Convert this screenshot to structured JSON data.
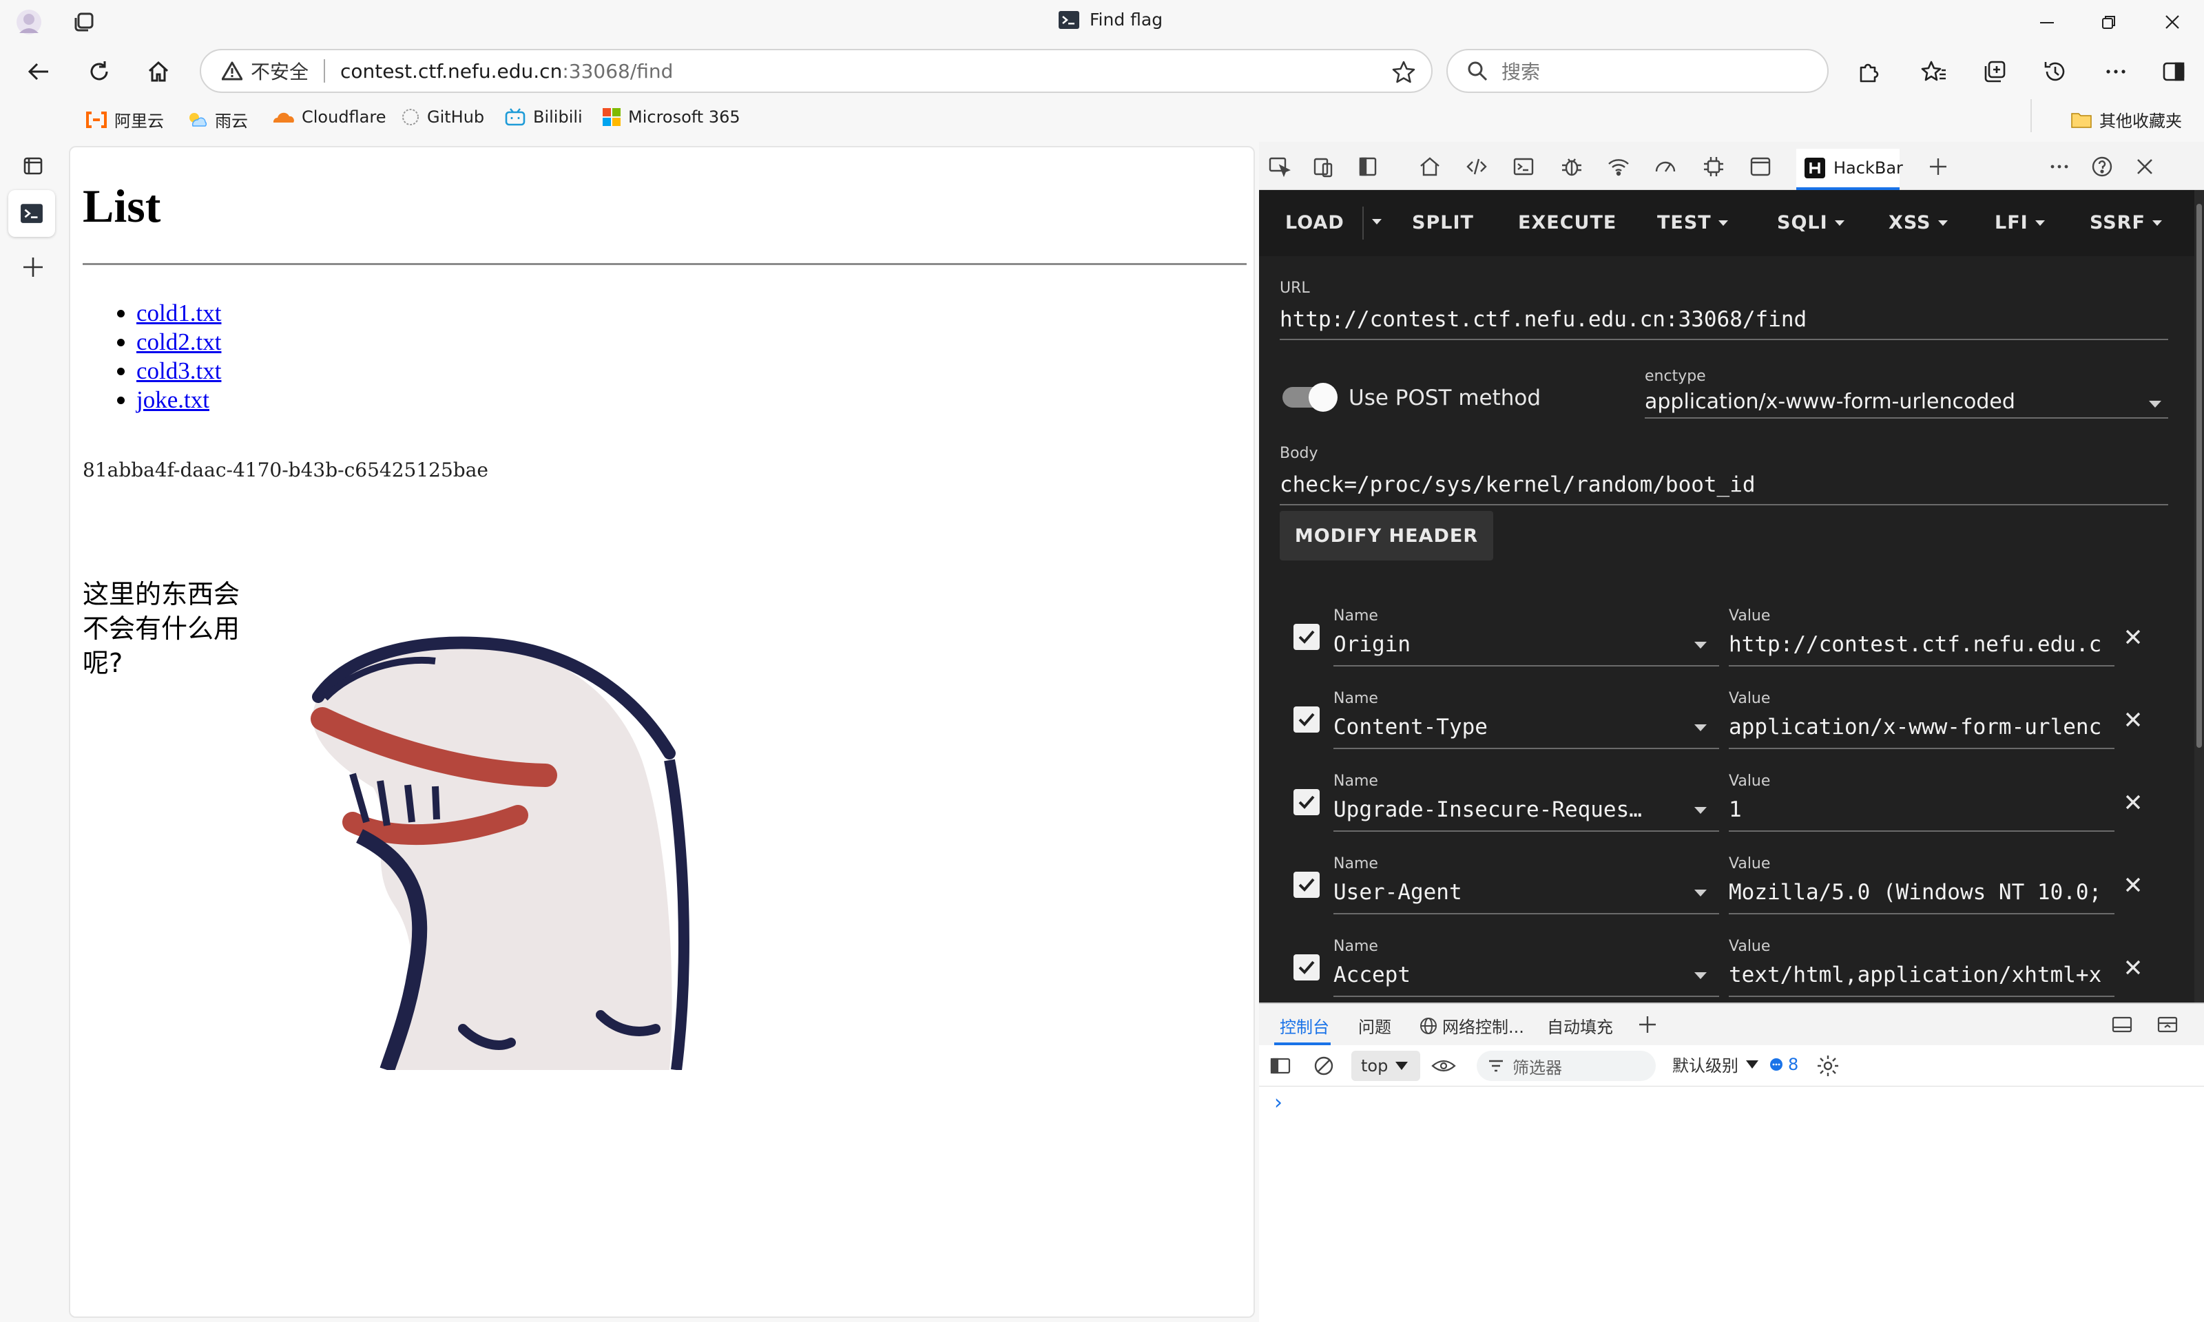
{
  "window": {
    "title": "Find flag"
  },
  "nav": {
    "security_label": "不安全",
    "url_host": "contest.ctf.nefu.edu.cn",
    "url_path": ":33068/find",
    "search_placeholder": "搜索"
  },
  "bookmarks": [
    {
      "label": "阿里云",
      "icon": "aliyun-icon",
      "color": "#ff6a00"
    },
    {
      "label": "雨云",
      "icon": "rainyun-icon",
      "color": "#4aa8ff"
    },
    {
      "label": "Cloudflare",
      "icon": "cloudflare-icon",
      "color": "#f38020"
    },
    {
      "label": "GitHub",
      "icon": "github-icon",
      "color": "#222222"
    },
    {
      "label": "Bilibili",
      "icon": "bilibili-icon",
      "color": "#1e9bd7"
    },
    {
      "label": "Microsoft 365",
      "icon": "microsoft-icon",
      "color": "#f25022"
    }
  ],
  "other_bookmarks": "其他收藏夹",
  "page": {
    "heading": "List",
    "files": [
      "cold1.txt",
      "cold2.txt",
      "cold3.txt",
      "joke.txt"
    ],
    "boot_id": "81abba4f-daac-4170-b43b-c65425125bae",
    "caption": "这里的东西会不会有什么用呢?"
  },
  "devtools": {
    "active_tab": "HackBar"
  },
  "hackbar": {
    "menu": {
      "load": "LOAD",
      "split": "SPLIT",
      "execute": "EXECUTE",
      "test": "TEST",
      "sqli": "SQLI",
      "xss": "XSS",
      "lfi": "LFI",
      "ssrf": "SSRF"
    },
    "url_label": "URL",
    "url": "http://contest.ctf.nefu.edu.cn:33068/find",
    "post_label": "Use POST method",
    "post_enabled": true,
    "enctype_label": "enctype",
    "enctype": "application/x-www-form-urlencoded",
    "body_label": "Body",
    "body": "check=/proc/sys/kernel/random/boot_id",
    "modify_header": "MODIFY HEADER",
    "name_label": "Name",
    "value_label": "Value",
    "headers": [
      {
        "name": "Origin",
        "value": "http://contest.ctf.nefu.edu.c",
        "checked": true
      },
      {
        "name": "Content-Type",
        "value": "application/x-www-form-urlenc",
        "checked": true
      },
      {
        "name": "Upgrade-Insecure-Reques…",
        "value": "1",
        "checked": true
      },
      {
        "name": "User-Agent",
        "value": "Mozilla/5.0 (Windows NT 10.0;",
        "checked": true
      },
      {
        "name": "Accept",
        "value": "text/html,application/xhtml+x",
        "checked": true
      }
    ]
  },
  "drawer": {
    "tabs": {
      "console": "控制台",
      "issues": "问题",
      "network_conditions": "网络控制...",
      "autofill": "自动填充"
    },
    "context": "top",
    "filter_placeholder": "筛选器",
    "level": "默认级别",
    "issue_count": "8",
    "prompt": "›"
  }
}
